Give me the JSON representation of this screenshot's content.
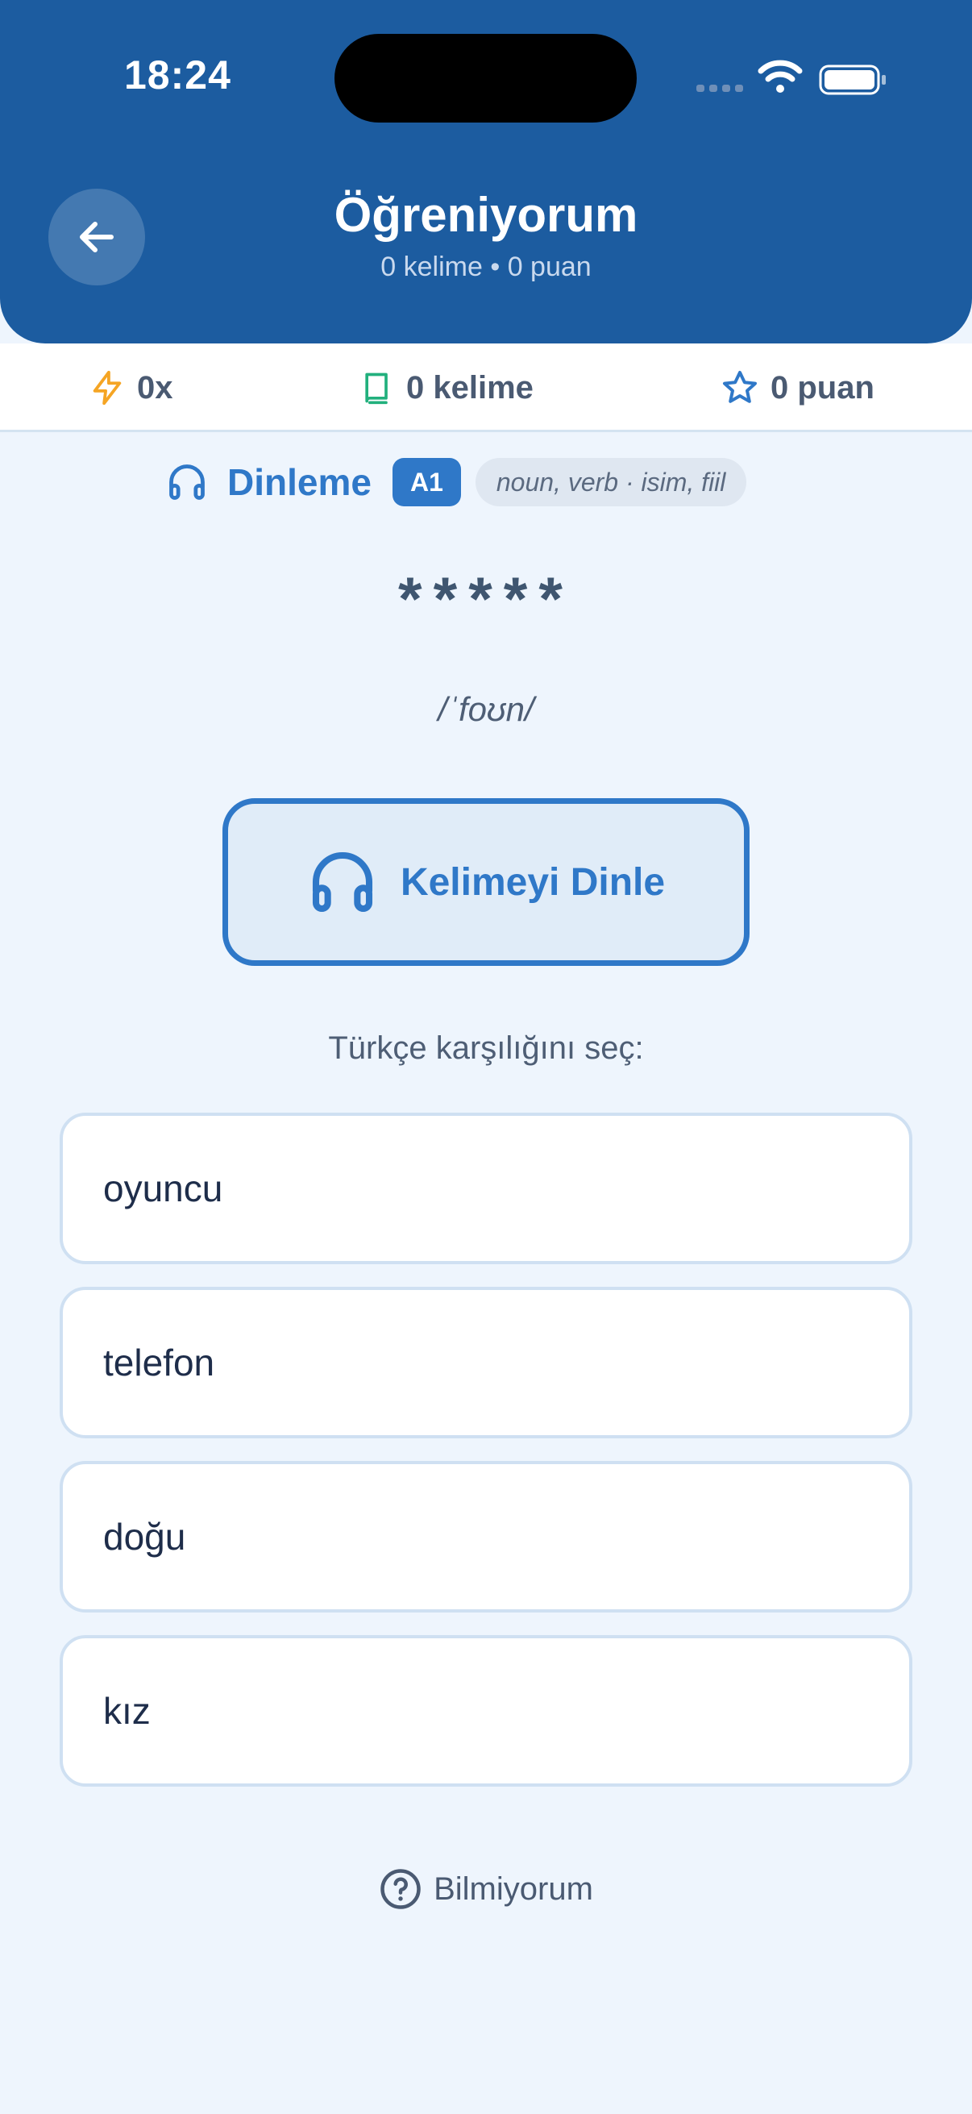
{
  "status_bar": {
    "time": "18:24"
  },
  "header": {
    "title": "Öğreniyorum",
    "subtitle": "0 kelime • 0 puan",
    "back_icon": "arrow-left-icon"
  },
  "stats": {
    "streak": "0x",
    "words": "0 kelime",
    "points": "0 puan",
    "colors": {
      "streak_icon": "#f5a524",
      "words_icon": "#22b07d",
      "points_icon": "#2f78c8"
    }
  },
  "exercise": {
    "mode": "Dinleme",
    "level": "A1",
    "part_of_speech": "noun, verb · isim, fiil",
    "masked_word": "*****",
    "phonetic": "/ˈfoʊn/",
    "listen_button": "Kelimeyi Dinle",
    "prompt": "Türkçe karşılığını seç:",
    "options": [
      {
        "label": "oyuncu"
      },
      {
        "label": "telefon"
      },
      {
        "label": "doğu"
      },
      {
        "label": "kız"
      }
    ],
    "dont_know": "Bilmiyorum"
  },
  "colors": {
    "header_bg": "#1c5ca0",
    "accent": "#2f78c8",
    "page_bg": "#eef5fd"
  }
}
